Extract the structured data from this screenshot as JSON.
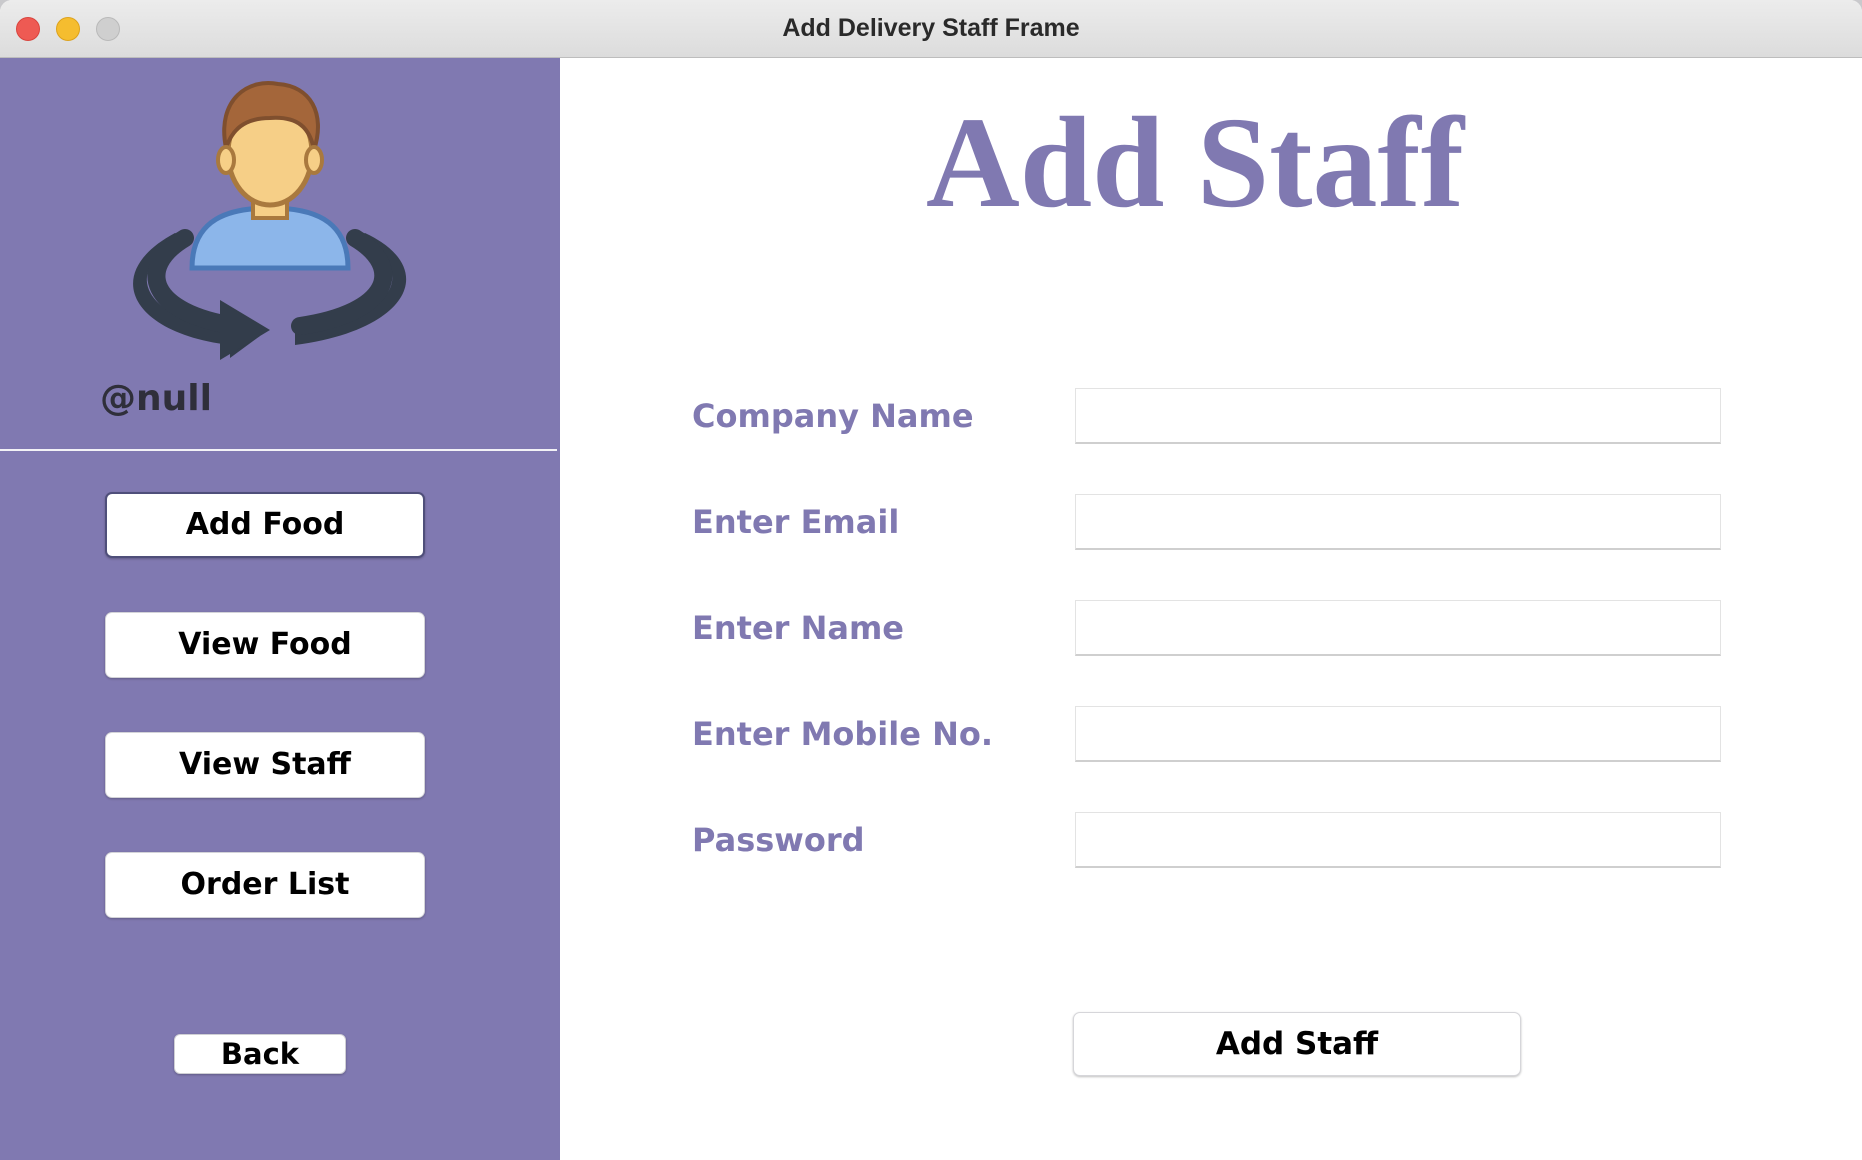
{
  "window": {
    "title": "Add Delivery Staff Frame"
  },
  "sidebar": {
    "avatar_icon": "user-rotate-icon",
    "username": "@null",
    "buttons": [
      {
        "label": "Add Food",
        "active": true
      },
      {
        "label": "View Food",
        "active": false
      },
      {
        "label": "View Staff",
        "active": false
      },
      {
        "label": "Order List",
        "active": false
      }
    ],
    "back_label": "Back"
  },
  "main": {
    "title": "Add Staff",
    "fields": [
      {
        "label": "Company Name",
        "value": "",
        "placeholder": ""
      },
      {
        "label": "Enter Email",
        "value": "",
        "placeholder": ""
      },
      {
        "label": "Enter Name",
        "value": "",
        "placeholder": ""
      },
      {
        "label": "Enter Mobile No.",
        "value": "",
        "placeholder": ""
      },
      {
        "label": "Password",
        "value": "",
        "placeholder": ""
      }
    ],
    "submit_label": "Add Staff"
  },
  "colors": {
    "accent": "#8079b1",
    "sidebar_bg": "#8079b1",
    "main_bg": "#ffffff"
  }
}
